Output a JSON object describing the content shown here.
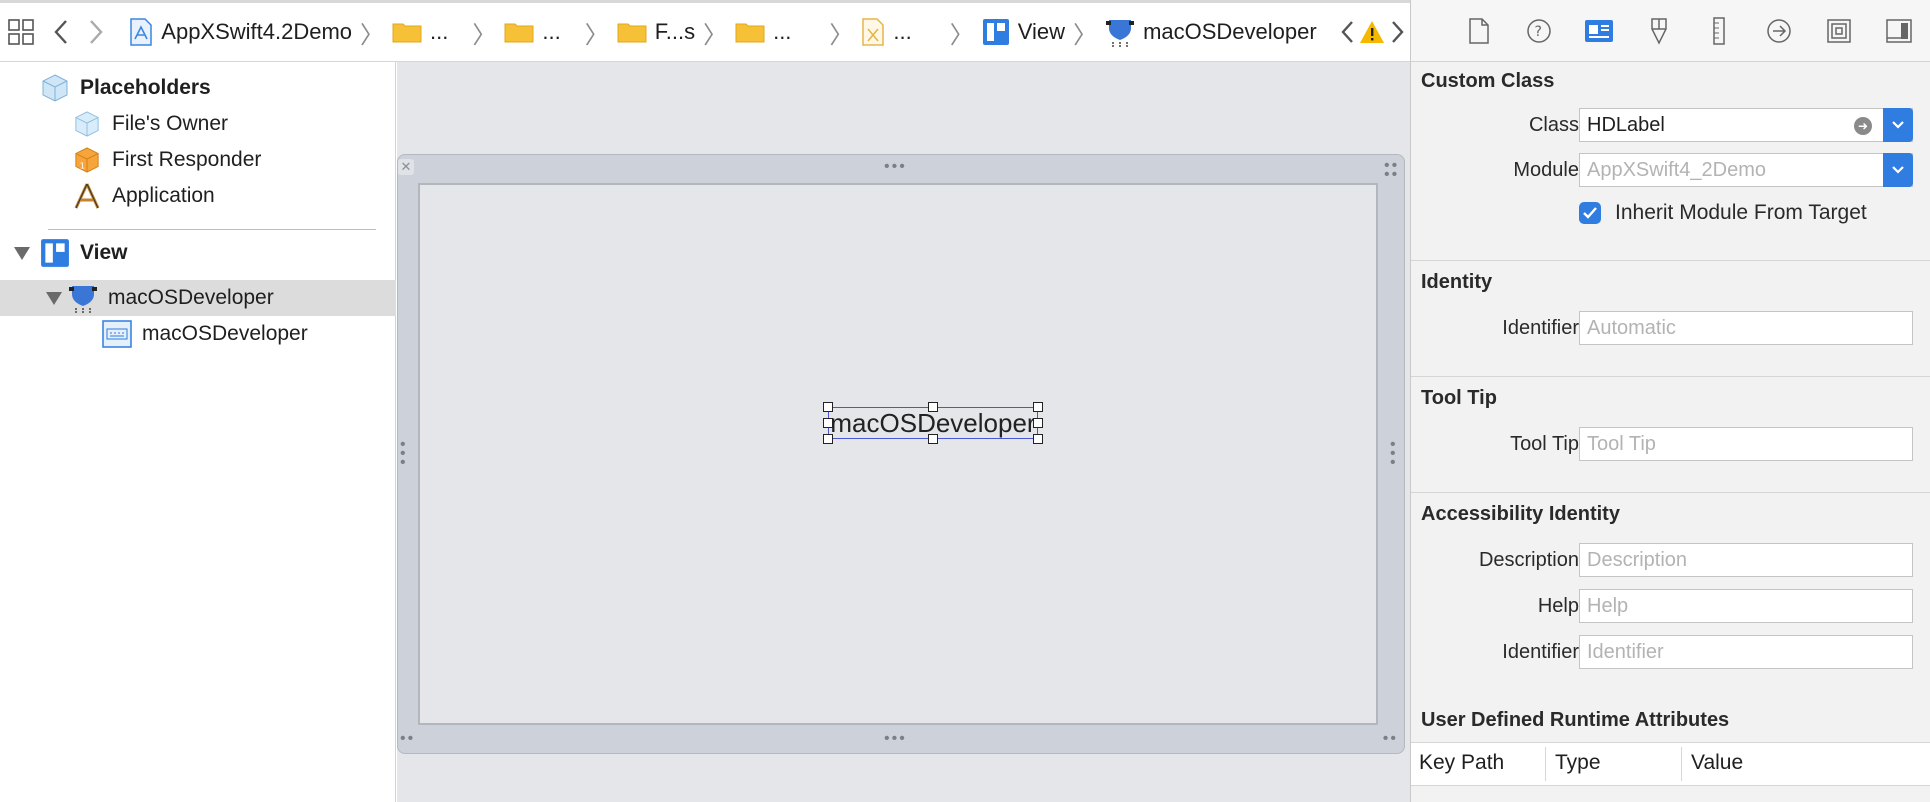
{
  "jumpbar": {
    "project": "AppXSwift4.2Demo",
    "crumb1": "...",
    "crumb2": "...",
    "crumb3": "F...s",
    "crumb4": "...",
    "crumb5": "...",
    "view": "View",
    "object": "macOSDeveloper"
  },
  "outline": {
    "placeholders": "Placeholders",
    "files_owner": "File's Owner",
    "first_responder": "First Responder",
    "application": "Application",
    "view": "View",
    "custom_view": "macOSDeveloper",
    "label": "macOSDeveloper"
  },
  "canvas": {
    "label_text": "macOSDeveloper"
  },
  "inspector": {
    "custom_class": {
      "title": "Custom Class",
      "class_label": "Class",
      "class_value": "HDLabel",
      "module_label": "Module",
      "module_placeholder": "AppXSwift4_2Demo",
      "inherit_label": "Inherit Module From Target",
      "inherit_checked": true
    },
    "identity": {
      "title": "Identity",
      "identifier_label": "Identifier",
      "identifier_placeholder": "Automatic"
    },
    "tooltip": {
      "title": "Tool Tip",
      "label": "Tool Tip",
      "placeholder": "Tool Tip"
    },
    "accessibility": {
      "title": "Accessibility Identity",
      "description_label": "Description",
      "description_placeholder": "Description",
      "help_label": "Help",
      "help_placeholder": "Help",
      "identifier_label": "Identifier",
      "identifier_placeholder": "Identifier"
    },
    "runtime": {
      "title": "User Defined Runtime Attributes",
      "columns": [
        "Key Path",
        "Type",
        "Value"
      ]
    }
  },
  "colors": {
    "accent": "#2f7de1",
    "selection": "#4a55d8",
    "folder": "#f6c136",
    "warning": "#f5b800"
  }
}
